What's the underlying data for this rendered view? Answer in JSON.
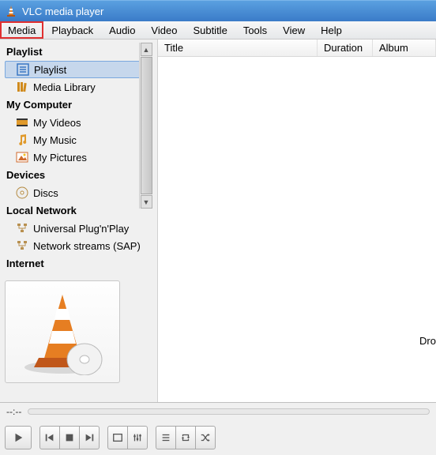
{
  "window": {
    "title": "VLC media player"
  },
  "menu": {
    "items": [
      {
        "label": "Media",
        "highlight": true
      },
      {
        "label": "Playback"
      },
      {
        "label": "Audio"
      },
      {
        "label": "Video"
      },
      {
        "label": "Subtitle"
      },
      {
        "label": "Tools"
      },
      {
        "label": "View"
      },
      {
        "label": "Help"
      }
    ]
  },
  "sidebar": {
    "groups": [
      {
        "header": "Playlist",
        "items": [
          {
            "label": "Playlist",
            "icon": "playlist-icon",
            "selected": true
          },
          {
            "label": "Media Library",
            "icon": "library-icon"
          }
        ]
      },
      {
        "header": "My Computer",
        "items": [
          {
            "label": "My Videos",
            "icon": "video-icon"
          },
          {
            "label": "My Music",
            "icon": "music-icon"
          },
          {
            "label": "My Pictures",
            "icon": "picture-icon"
          }
        ]
      },
      {
        "header": "Devices",
        "items": [
          {
            "label": "Discs",
            "icon": "disc-icon"
          }
        ]
      },
      {
        "header": "Local Network",
        "items": [
          {
            "label": "Universal Plug'n'Play",
            "icon": "network-icon"
          },
          {
            "label": "Network streams (SAP)",
            "icon": "network-icon"
          }
        ]
      },
      {
        "header": "Internet",
        "items": []
      }
    ]
  },
  "columns": {
    "title": "Title",
    "duration": "Duration",
    "album": "Album"
  },
  "main": {
    "drop_hint": "Dro"
  },
  "time": "--:--",
  "icons": {
    "playlist": "#3b78c4",
    "library": "#d08a1c",
    "video": "#e09a2c",
    "music": "#e09a2c",
    "picture": "#d06a2c",
    "disc": "#d0a060",
    "network": "#b89050"
  }
}
